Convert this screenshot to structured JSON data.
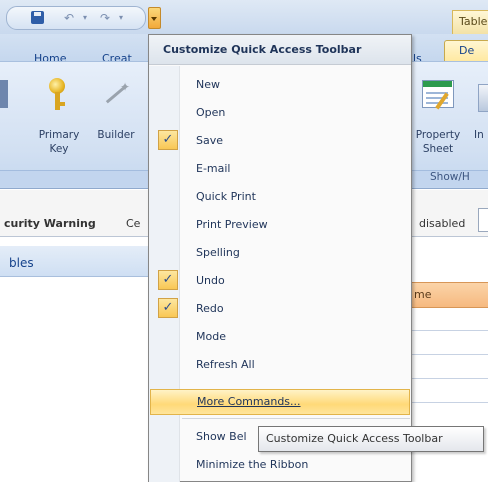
{
  "window": {
    "context_tab_label": "Table"
  },
  "quick_access_toolbar": {
    "save_icon": "save-icon",
    "undo_icon": "undo-icon",
    "redo_icon": "redo-icon",
    "customize_dropdown_icon": "chevron-down-icon"
  },
  "ribbon": {
    "tabs": [
      {
        "label": "Home"
      },
      {
        "label": "Creat"
      },
      {
        "label": "ls"
      }
    ],
    "active_tab": {
      "label": "De"
    },
    "buttons": {
      "primary_key": {
        "label_line1": "Primary",
        "label_line2": "Key",
        "icon": "key-icon"
      },
      "builder": {
        "label": "Builder",
        "icon": "wand-icon"
      },
      "property_sheet": {
        "label_line1": "Property",
        "label_line2": "Sheet",
        "icon": "property-sheet-icon"
      },
      "partial_right": {
        "label": "In"
      }
    },
    "groups": {
      "show_hide": "Show/H"
    }
  },
  "message_bar": {
    "warning_label": "curity Warning",
    "partial_text": "Ce",
    "status_text": "disabled"
  },
  "navigation_pane": {
    "title": "bles"
  },
  "table": {
    "column_header": "me"
  },
  "menu": {
    "header": "Customize Quick Access Toolbar",
    "items": [
      {
        "label": "New",
        "checked": false
      },
      {
        "label": "Open",
        "checked": false
      },
      {
        "label": "Save",
        "checked": true
      },
      {
        "label": "E-mail",
        "checked": false
      },
      {
        "label": "Quick Print",
        "checked": false
      },
      {
        "label": "Print Preview",
        "checked": false
      },
      {
        "label": "Spelling",
        "checked": false
      },
      {
        "label": "Undo",
        "checked": true
      },
      {
        "label": "Redo",
        "checked": true
      },
      {
        "label": "Mode",
        "checked": false
      },
      {
        "label": "Refresh All",
        "checked": false
      }
    ],
    "more_commands": {
      "label": "More Commands...",
      "highlighted": true
    },
    "show_below": {
      "label": "Show Bel"
    },
    "minimize_ribbon": {
      "label": "Minimize the Ribbon"
    },
    "check_glyph": "✓"
  },
  "tooltip": {
    "text": "Customize Quick Access Toolbar"
  },
  "colors": {
    "highlight": "#ffd978",
    "check_box": "#f9c755",
    "ribbon_blue": "#d2e0f2",
    "column_header": "#f6b980"
  }
}
